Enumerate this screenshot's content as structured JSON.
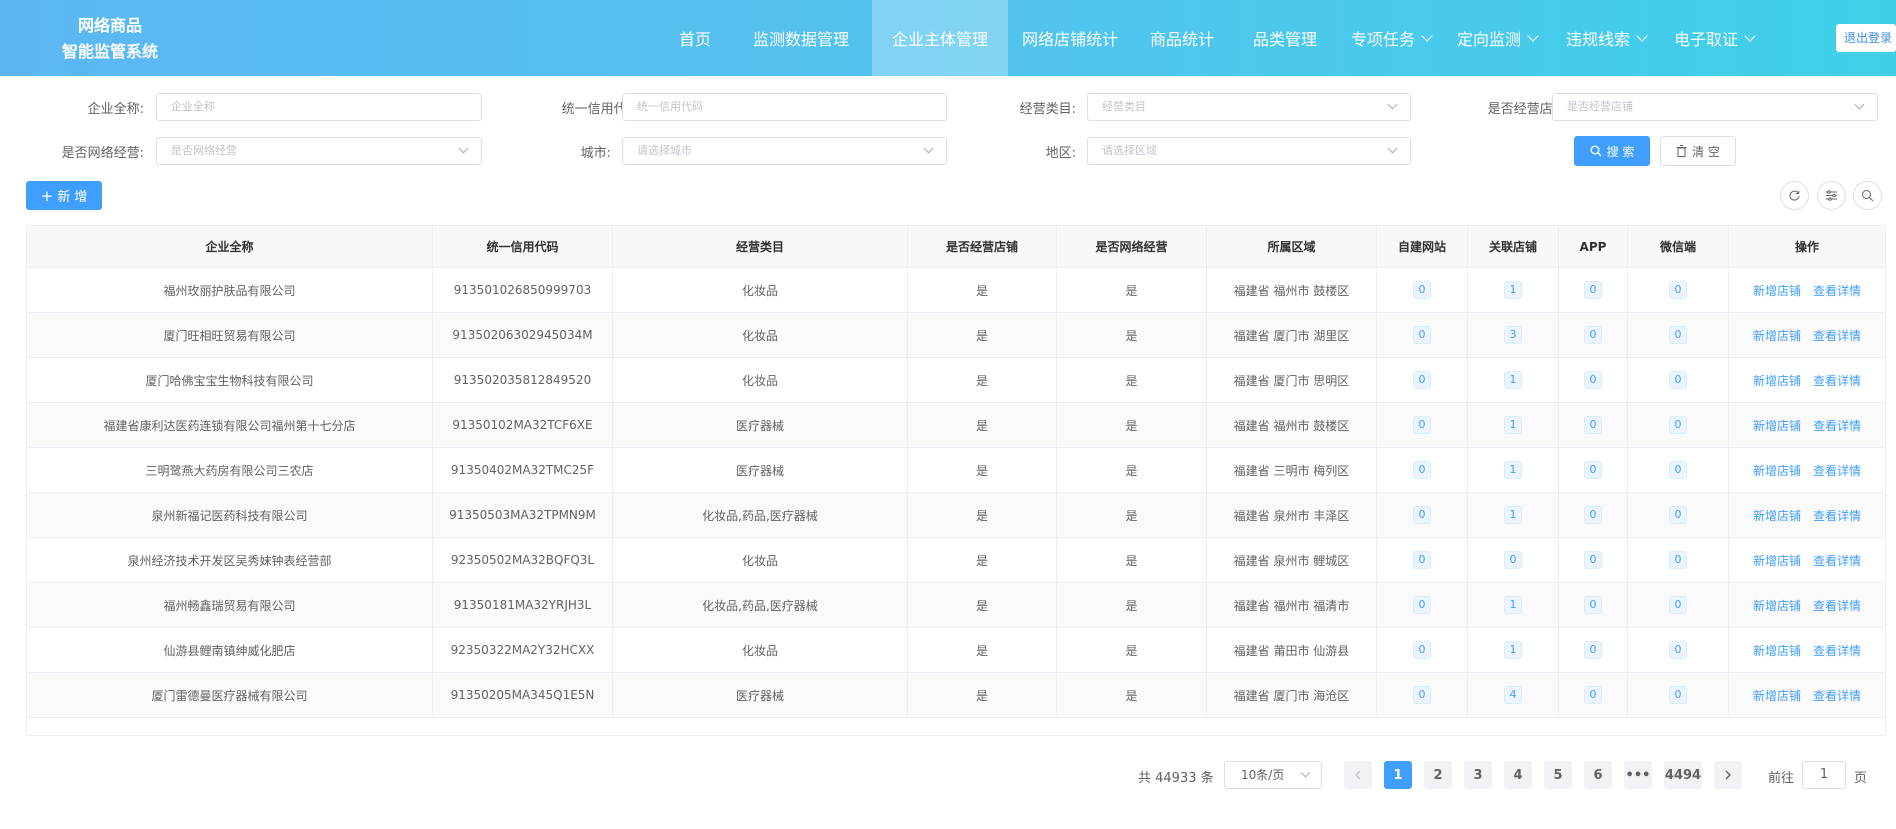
{
  "app": {
    "title_line1": "网络商品",
    "title_line2": "智能监管系统"
  },
  "nav": [
    {
      "label": "首页",
      "dropdown": false,
      "active": false
    },
    {
      "label": "监测数据管理",
      "dropdown": false,
      "active": false
    },
    {
      "label": "企业主体管理",
      "dropdown": false,
      "active": true
    },
    {
      "label": "网络店铺统计",
      "dropdown": false,
      "active": false
    },
    {
      "label": "商品统计",
      "dropdown": false,
      "active": false
    },
    {
      "label": "品类管理",
      "dropdown": false,
      "active": false
    },
    {
      "label": "专项任务",
      "dropdown": true,
      "active": false
    },
    {
      "label": "定向监测",
      "dropdown": true,
      "active": false
    },
    {
      "label": "违规线索",
      "dropdown": true,
      "active": false
    },
    {
      "label": "电子取证",
      "dropdown": true,
      "active": false
    }
  ],
  "logout_label": "退出登录",
  "search": {
    "company_name": {
      "label": "企业全称:",
      "placeholder": "企业全称"
    },
    "credit_code": {
      "label": "统一信用代码:",
      "placeholder": "统一信用代码"
    },
    "category": {
      "label": "经营类目:",
      "placeholder": "经营类目"
    },
    "has_shop": {
      "label": "是否经营店铺:",
      "placeholder": "是否经营店铺"
    },
    "online": {
      "label": "是否网络经营:",
      "placeholder": "是否网络经营"
    },
    "city": {
      "label": "城市:",
      "placeholder": "请选择城市"
    },
    "region": {
      "label": "地区:",
      "placeholder": "请选择区域"
    },
    "search_btn": "搜 索",
    "clear_btn": "清 空"
  },
  "add_btn": "新 增",
  "table": {
    "headers": [
      "企业全称",
      "统一信用代码",
      "经营类目",
      "是否经营店铺",
      "是否网络经营",
      "所属区域",
      "自建网站",
      "关联店铺",
      "APP",
      "微信端",
      "操作"
    ],
    "rows": [
      [
        "福州玫丽护肤品有限公司",
        "913501026850999703",
        "化妆品",
        "是",
        "是",
        "福建省 福州市 鼓楼区",
        "0",
        "1",
        "0",
        "0"
      ],
      [
        "厦门旺相旺贸易有限公司",
        "91350206302945034M",
        "化妆品",
        "是",
        "是",
        "福建省 厦门市 湖里区",
        "0",
        "3",
        "0",
        "0"
      ],
      [
        "厦门哈佛宝宝生物科技有限公司",
        "913502035812849520",
        "化妆品",
        "是",
        "是",
        "福建省 厦门市 思明区",
        "0",
        "1",
        "0",
        "0"
      ],
      [
        "福建省康利达医药连锁有限公司福州第十七分店",
        "91350102MA32TCF6XE",
        "医疗器械",
        "是",
        "是",
        "福建省 福州市 鼓楼区",
        "0",
        "1",
        "0",
        "0"
      ],
      [
        "三明鹭燕大药房有限公司三农店",
        "91350402MA32TMC25F",
        "医疗器械",
        "是",
        "是",
        "福建省 三明市 梅列区",
        "0",
        "1",
        "0",
        "0"
      ],
      [
        "泉州新福记医药科技有限公司",
        "91350503MA32TPMN9M",
        "化妆品,药品,医疗器械",
        "是",
        "是",
        "福建省 泉州市 丰泽区",
        "0",
        "1",
        "0",
        "0"
      ],
      [
        "泉州经济技术开发区吴秀妹钟表经营部",
        "92350502MA32BQFQ3L",
        "化妆品",
        "是",
        "是",
        "福建省 泉州市 鲤城区",
        "0",
        "0",
        "0",
        "0"
      ],
      [
        "福州畅鑫瑞贸易有限公司",
        "91350181MA32YRJH3L",
        "化妆品,药品,医疗器械",
        "是",
        "是",
        "福建省 福州市 福清市",
        "0",
        "1",
        "0",
        "0"
      ],
      [
        "仙游县鲤南镇绅威化肥店",
        "92350322MA2Y32HCXX",
        "化妆品",
        "是",
        "是",
        "福建省 莆田市 仙游县",
        "0",
        "1",
        "0",
        "0"
      ],
      [
        "厦门雷德曼医疗器械有限公司",
        "91350205MA345Q1E5N",
        "医疗器械",
        "是",
        "是",
        "福建省 厦门市 海沧区",
        "0",
        "4",
        "0",
        "0"
      ]
    ],
    "actions": [
      "新增店铺",
      "查看详情"
    ]
  },
  "pagination": {
    "total": "共 44933 条",
    "page_size": "10条/页",
    "pages": [
      "1",
      "2",
      "3",
      "4",
      "5",
      "6",
      "•••",
      "4494"
    ],
    "current": "1",
    "goto_label": "前往",
    "goto_value": "1",
    "goto_unit": "页"
  },
  "colors": {
    "primary": "#409eff",
    "header_start": "#5cb6f2",
    "header_end": "#3fd0e8"
  }
}
